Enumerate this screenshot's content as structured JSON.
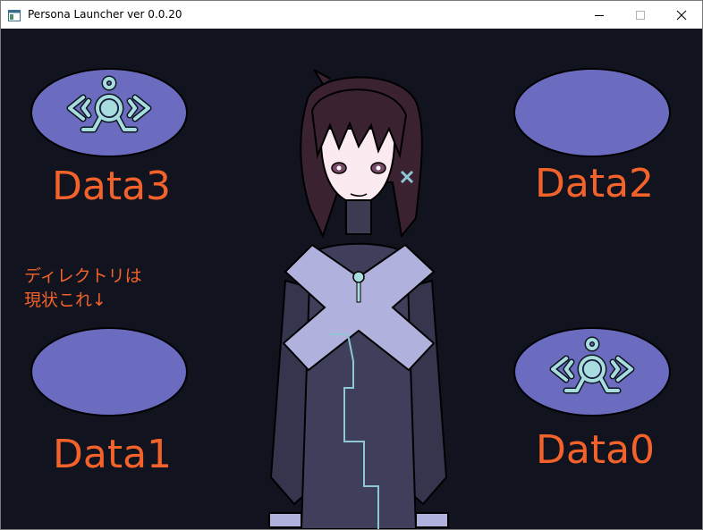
{
  "window": {
    "title": "Persona Launcher ver 0.0.20",
    "icon": "app-window-icon",
    "controls": [
      "minimize-icon",
      "maximize-icon",
      "close-icon"
    ]
  },
  "slots": {
    "data3": {
      "label": "Data3",
      "has_emblem": true
    },
    "data2": {
      "label": "Data2",
      "has_emblem": false
    },
    "data1": {
      "label": "Data1",
      "has_emblem": false
    },
    "data0": {
      "label": "Data0",
      "has_emblem": true
    }
  },
  "note": {
    "line1": "ディレクトリは",
    "line2": "現状これ↓"
  },
  "colors": {
    "background": "#11131f",
    "slot_fill": "#6b6cbf",
    "emblem": "#a8dde0",
    "label": "#f2622a"
  }
}
